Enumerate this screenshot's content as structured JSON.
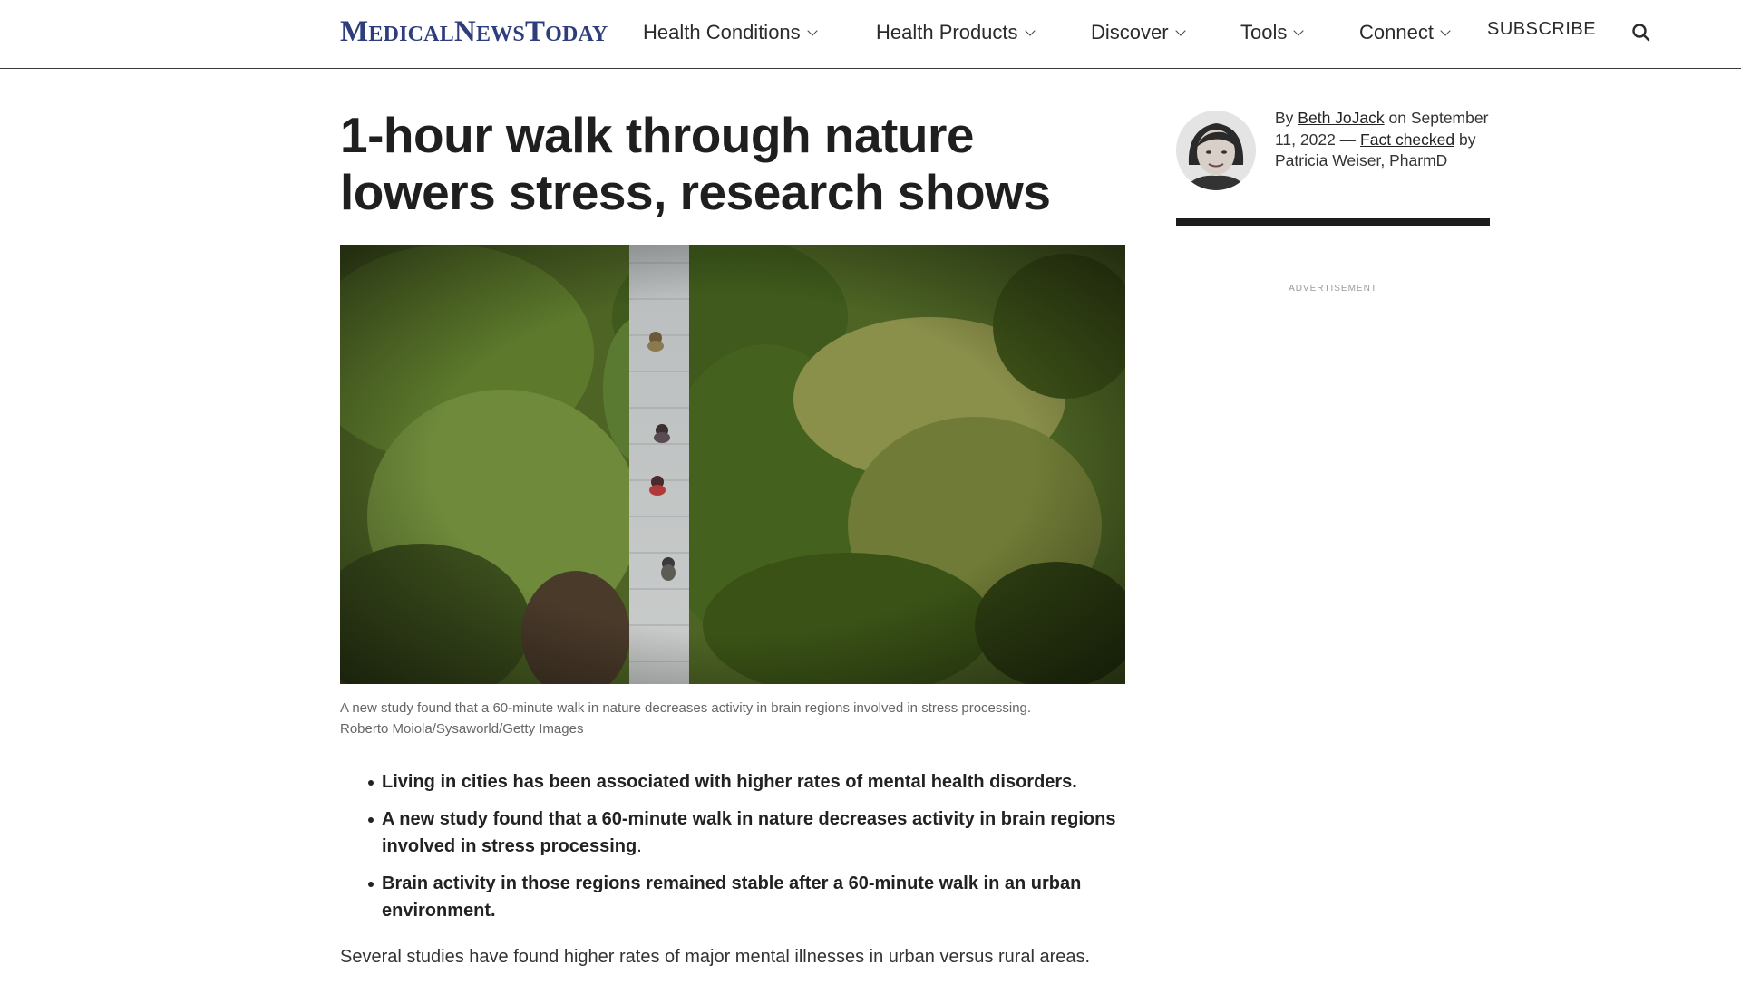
{
  "header": {
    "logo_parts": [
      "M",
      "edical",
      "N",
      "ews",
      "T",
      "oday"
    ],
    "nav": [
      {
        "label": "Health Conditions"
      },
      {
        "label": "Health Products"
      },
      {
        "label": "Discover"
      },
      {
        "label": "Tools"
      },
      {
        "label": "Connect"
      }
    ],
    "subscribe_label": "SUBSCRIBE",
    "search_icon": "search-icon"
  },
  "article": {
    "title": "1-hour walk through nature lowers stress, research shows",
    "image_caption": "A new study found that a 60-minute walk in nature decreases activity in brain regions involved in stress processing.",
    "image_credit": "Roberto Moiola/Sysaworld/Getty Images",
    "key_points": [
      {
        "text": "Living in cities has been associated with higher rates of mental health disorders.",
        "tail": ""
      },
      {
        "text": "A new study found that a 60-minute walk in nature decreases activity in brain regions involved in stress processing",
        "tail": "."
      },
      {
        "text": "Brain activity in those regions remained stable after a 60-minute walk in an urban environment.",
        "tail": ""
      }
    ],
    "lead_paragraph": "Several studies have found higher rates of major mental illnesses in urban versus rural areas."
  },
  "byline": {
    "by": "By ",
    "author": "Beth JoJack",
    "on_date": " on September 11, 2022 — ",
    "fact_checked": "Fact checked",
    "fact_checker": " by Patricia Weiser, PharmD"
  },
  "sidebar": {
    "ad_label": "ADVERTISEMENT"
  },
  "colors": {
    "brand": "#2e3d7c",
    "text": "#1f1f1f",
    "caption": "#666666"
  }
}
